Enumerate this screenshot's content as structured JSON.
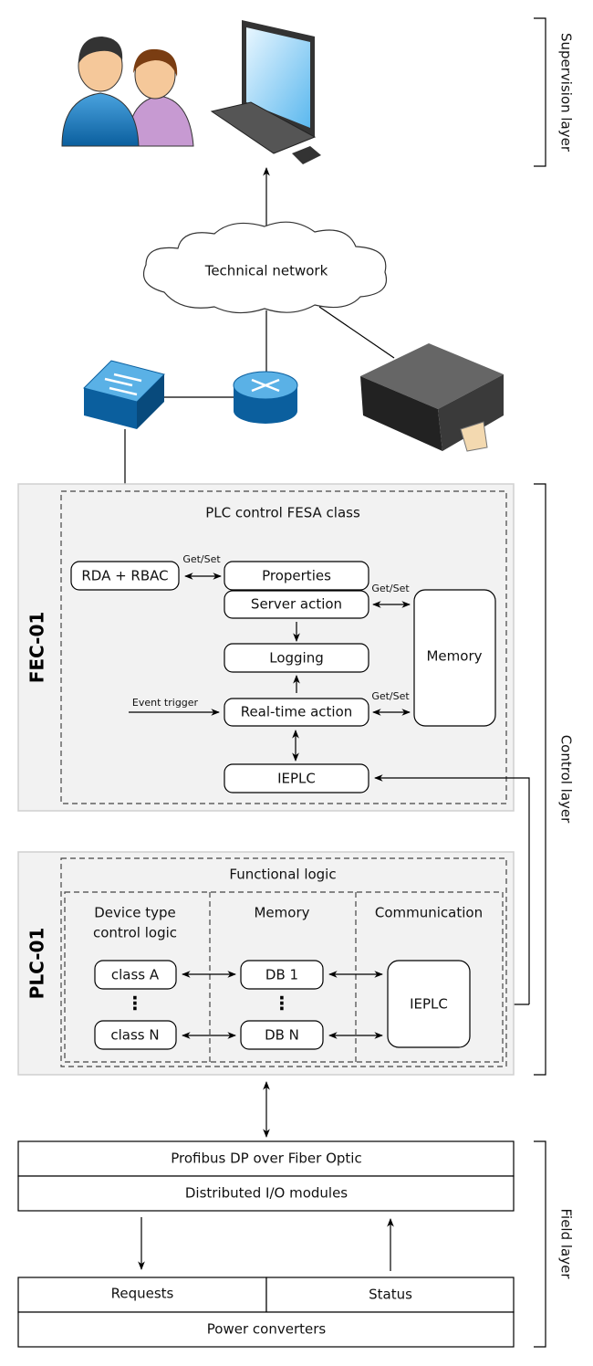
{
  "layers": {
    "supervision": "Supervision layer",
    "control": "Control layer",
    "field": "Field layer"
  },
  "network": {
    "cloud_label": "Technical network"
  },
  "icons": {
    "users": "users-icon",
    "computer": "computer-icon",
    "switch": "network-switch-icon",
    "router": "router-icon",
    "server": "server-icon"
  },
  "fec": {
    "name": "FEC-01",
    "title": "PLC control FESA class",
    "rda": "RDA + RBAC",
    "properties": "Properties",
    "server_action": "Server action",
    "logging": "Logging",
    "realtime_action": "Real-time action",
    "ieplc": "IEPLC",
    "memory": "Memory",
    "get_set": "Get/Set",
    "event_trigger": "Event trigger"
  },
  "plc": {
    "name": "PLC-01",
    "title": "Functional logic",
    "col1_line1": "Device type",
    "col1_line2": "control logic",
    "col2": "Memory",
    "col3": "Communication",
    "class_a": "class A",
    "class_n": "class N",
    "db1": "DB 1",
    "dbn": "DB N",
    "ieplc": "IEPLC",
    "dots": "⋮"
  },
  "field": {
    "profibus": "Profibus DP over Fiber Optic",
    "io": "Distributed I/O modules",
    "requests": "Requests",
    "status": "Status",
    "power": "Power converters"
  }
}
